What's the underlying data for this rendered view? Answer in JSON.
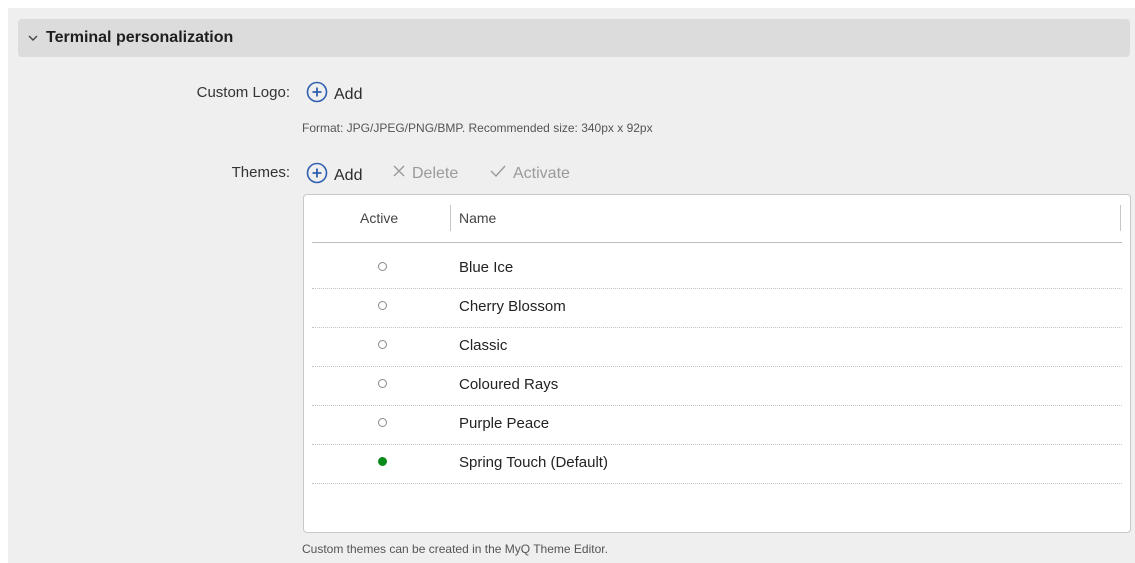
{
  "section": {
    "title": "Terminal personalization"
  },
  "custom_logo": {
    "label": "Custom Logo:",
    "add_label": "Add",
    "hint": "Format: JPG/JPEG/PNG/BMP. Recommended size: 340px x 92px"
  },
  "themes": {
    "label": "Themes:",
    "toolbar": {
      "add": "Add",
      "delete": "Delete",
      "activate": "Activate"
    },
    "columns": {
      "active": "Active",
      "name": "Name"
    },
    "rows": [
      {
        "name": "Blue Ice",
        "active": false
      },
      {
        "name": "Cherry Blossom",
        "active": false
      },
      {
        "name": "Classic",
        "active": false
      },
      {
        "name": "Coloured Rays",
        "active": false
      },
      {
        "name": "Purple Peace",
        "active": false
      },
      {
        "name": "Spring Touch (Default)",
        "active": true
      }
    ],
    "footer_hint": "Custom themes can be created in the MyQ Theme Editor."
  },
  "colors": {
    "accent": "#2f5fb0",
    "active_indicator": "#0a8a1a"
  },
  "icons": {
    "collapse": "chevron-down-icon",
    "add": "plus-circle-icon",
    "delete": "x-icon",
    "activate": "check-icon"
  }
}
